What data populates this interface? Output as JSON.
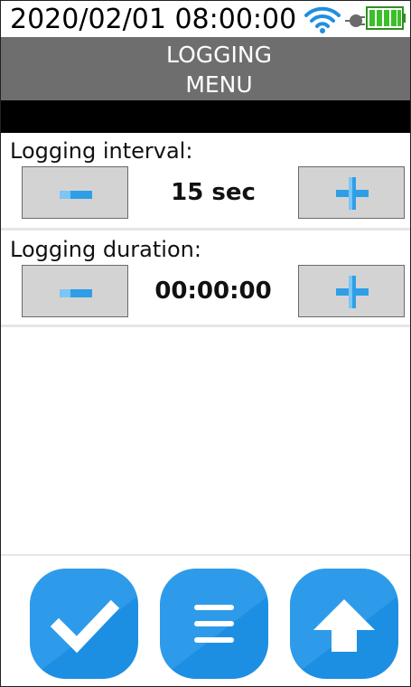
{
  "status": {
    "datetime": "2020/02/01 08:00:00",
    "icons": [
      "wifi-icon",
      "plug-icon",
      "battery-icon"
    ],
    "wifi_color": "#1f8fe0",
    "battery_color": "#3cbf2a"
  },
  "header": {
    "title_line1": "LOGGING",
    "title_line2": "MENU",
    "background": "#6e6e6e"
  },
  "logging_interval": {
    "label": "Logging interval:",
    "value": "15 sec"
  },
  "logging_duration": {
    "label": "Logging duration:",
    "value": "00:00:00"
  },
  "controls": {
    "decrement_icon": "minus-icon",
    "increment_icon": "plus-icon",
    "button_background": "#d3d3d3",
    "accent": "#2e9fe6"
  },
  "footer": {
    "buttons": [
      {
        "icon": "checkmark-icon"
      },
      {
        "icon": "menu-icon"
      },
      {
        "icon": "up-arrow-icon"
      }
    ],
    "button_color": "#1c8fe3"
  }
}
